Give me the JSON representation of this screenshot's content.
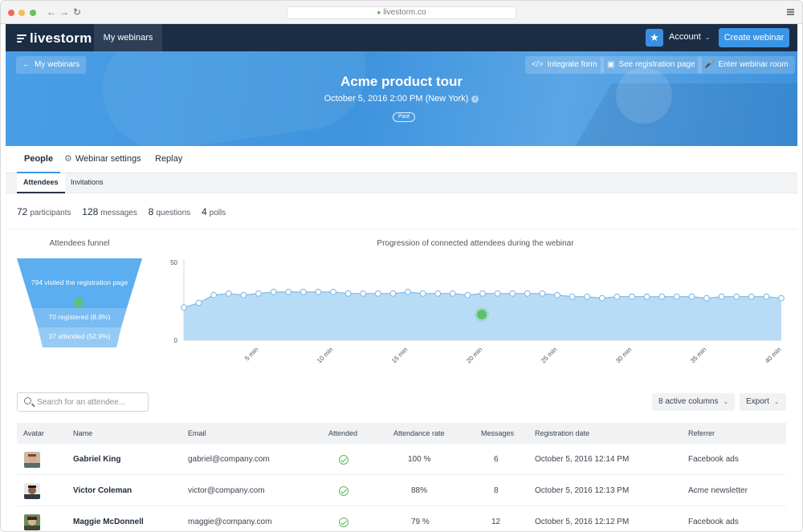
{
  "browser": {
    "url": "livestorm.co"
  },
  "topnav": {
    "logo": "livestorm",
    "my_webinars": "My webinars",
    "account": "Account",
    "create_webinar": "Create webinar"
  },
  "hero": {
    "back": "My webinars",
    "integrate_form": "Integrate form",
    "see_registration": "See registration page",
    "enter_room": "Enter webinar room",
    "title": "Acme product tour",
    "date": "October 5, 2016 2:00 PM (New York)",
    "badge": "Past"
  },
  "tabs": {
    "people": "People",
    "settings": "Webinar settings",
    "replay": "Replay"
  },
  "subtabs": {
    "attendees": "Attendees",
    "invitations": "Invitations"
  },
  "stats": [
    {
      "value": "72",
      "label": "participants"
    },
    {
      "value": "128",
      "label": "messages"
    },
    {
      "value": "8",
      "label": "questions"
    },
    {
      "value": "4",
      "label": "polls"
    }
  ],
  "funnel": {
    "title": "Attendees funnel",
    "levels": [
      "794 visited the registration page",
      "70 registered (8.8%)",
      "37 attended (52.9%)"
    ]
  },
  "chart_data": {
    "type": "area",
    "title": "Progression of connected attendees during the webinar",
    "ylim": [
      0,
      50
    ],
    "yticks": [
      "50",
      "0"
    ],
    "xticks": [
      "5 min",
      "10 min",
      "15 min",
      "20 min",
      "25 min",
      "30 min",
      "35 min",
      "40 min"
    ],
    "xtick_positions": [
      5,
      10,
      15,
      20,
      25,
      30,
      35,
      40
    ],
    "x": [
      0,
      1,
      2,
      3,
      4,
      5,
      6,
      7,
      8,
      9,
      10,
      11,
      12,
      13,
      14,
      15,
      16,
      17,
      18,
      19,
      20,
      21,
      22,
      23,
      24,
      25,
      26,
      27,
      28,
      29,
      30,
      31,
      32,
      33,
      34,
      35,
      36,
      37,
      38,
      39,
      40
    ],
    "values": [
      21,
      24,
      29,
      30,
      29,
      30,
      31,
      31,
      31,
      31,
      31,
      30,
      30,
      30,
      30,
      31,
      30,
      30,
      30,
      29,
      30,
      30,
      30,
      30,
      30,
      29,
      28,
      28,
      27,
      28,
      28,
      28,
      28,
      28,
      28,
      27,
      28,
      28,
      28,
      28,
      27,
      27
    ],
    "color": "#b9dcf6",
    "line_color": "#7dbcea"
  },
  "toolbar": {
    "search_placeholder": "Search for an attendee...",
    "columns": "8 active columns",
    "export": "Export"
  },
  "table": {
    "headers": [
      "Avatar",
      "Name",
      "Email",
      "Attended",
      "Attendance rate",
      "Messages",
      "Registration date",
      "Referrer"
    ],
    "rows": [
      {
        "name": "Gabriel King",
        "email": "gabriel@company.com",
        "attended": true,
        "rate": "100 %",
        "messages": "6",
        "date": "October 5, 2016 12:14 PM",
        "referrer": "Facebook ads"
      },
      {
        "name": "Victor Coleman",
        "email": "victor@company.com",
        "attended": true,
        "rate": "88%",
        "messages": "8",
        "date": "October 5, 2016 12:13 PM",
        "referrer": "Acme newsletter"
      },
      {
        "name": "Maggie McDonnell",
        "email": "maggie@company.com",
        "attended": true,
        "rate": "79 %",
        "messages": "12",
        "date": "October 5, 2016 12:12 PM",
        "referrer": "Facebook ads"
      }
    ]
  },
  "colors": {
    "nav": "#1b2d45",
    "accent": "#3b95e6",
    "hero": "#4a9ee6",
    "success": "#5cb85c"
  }
}
